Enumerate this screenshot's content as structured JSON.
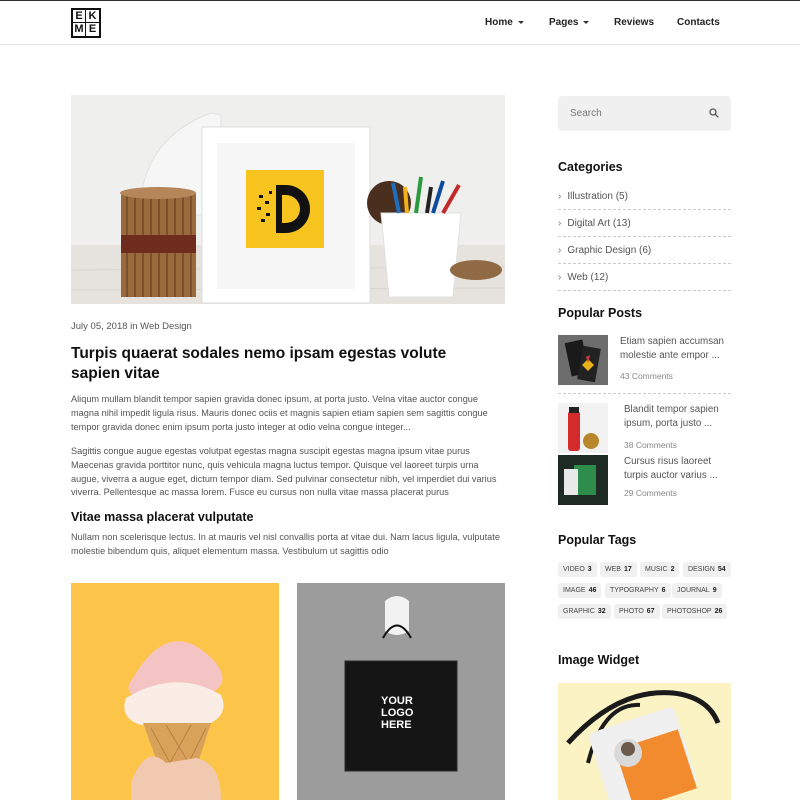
{
  "header": {
    "logo_letters": [
      "E",
      "K",
      "M",
      "E"
    ],
    "nav": [
      {
        "label": "Home",
        "has_caret": true
      },
      {
        "label": "Pages",
        "has_caret": true
      },
      {
        "label": "Reviews",
        "has_caret": false
      },
      {
        "label": "Contacts",
        "has_caret": false
      }
    ]
  },
  "post": {
    "meta": "July 05, 2018 in Web Design",
    "title": "Turpis quaerat sodales nemo ipsam egestas volute sapien vitae",
    "paragraph1": "Aliqum mullam blandit tempor sapien gravida donec ipsum, at porta justo. Velna vitae auctor congue magna nihil impedit ligula risus. Mauris donec ociis et magnis sapien etiam sapien sem sagittis congue tempor gravida donec enim ipsum porta justo integer at odio velna congue integer...",
    "paragraph2": "Sagittis congue augue egestas volutpat egestas magna suscipit egestas magna ipsum vitae purus Maecenas gravida porttitor nunc, quis vehicula magna luctus tempor. Quisque vel laoreet turpis urna augue, viverra a augue eget, dictum tempor diam. Sed pulvinar consectetur nibh, vel imperdiet dui varius viverra. Pellentesque ac massa lorem. Fusce eu cursus non nulla vitae massa placerat purus",
    "subtitle": "Vitae massa placerat vulputate",
    "paragraph3": "Nullam non scelerisque lectus. In at mauris vel nisl convallis porta at vitae dui. Nam lacus ligula, vulputate molestie bibendum quis, aliquet elementum massa. Vestibulum ut sagittis odio",
    "bag_text": [
      "YOUR",
      "LOGO",
      "HERE"
    ]
  },
  "sidebar": {
    "search_placeholder": "Search",
    "categories_title": "Categories",
    "categories": [
      "Illustration (5)",
      "Digital Art (13)",
      "Graphic Design (6)",
      "Web (12)"
    ],
    "popular_posts_title": "Popular Posts",
    "popular_posts": [
      {
        "title": "Etiam sapien accumsan molestie ante empor ...",
        "comments": "43 Comments"
      },
      {
        "title": "Blandit tempor sapien ipsum, porta justo ...",
        "comments": "38 Comments"
      },
      {
        "title": "Cursus risus laoreet turpis auctor varius ...",
        "comments": "29 Comments"
      }
    ],
    "popular_tags_title": "Popular Tags",
    "tags": [
      {
        "name": "VIDEO",
        "count": "3"
      },
      {
        "name": "WEB",
        "count": "17"
      },
      {
        "name": "MUSIC",
        "count": "2"
      },
      {
        "name": "DESIGN",
        "count": "54"
      },
      {
        "name": "IMAGE",
        "count": "46"
      },
      {
        "name": "TYPOGRAPHY",
        "count": "6"
      },
      {
        "name": "JOURNAL",
        "count": "9"
      },
      {
        "name": "GRAPHIC",
        "count": "32"
      },
      {
        "name": "PHOTO",
        "count": "67"
      },
      {
        "name": "PHOTOSHOP",
        "count": "26"
      }
    ],
    "image_widget_title": "Image Widget"
  },
  "colors": {
    "accent_yellow": "#f7c31f",
    "text_dark": "#111111",
    "text_muted": "#555555",
    "tag_bg": "#f0f0f0"
  }
}
